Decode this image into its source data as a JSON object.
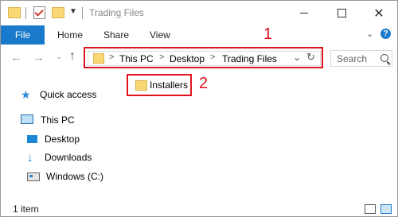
{
  "window": {
    "title": "Trading Files",
    "minimize_icon": "minimize-icon",
    "maximize_icon": "maximize-icon",
    "close_glyph": "✕"
  },
  "ribbon": {
    "file_label": "File",
    "tabs": [
      "Home",
      "Share",
      "View"
    ],
    "expand_glyph": "⌄",
    "help_glyph": "?"
  },
  "nav": {
    "back_glyph": "←",
    "forward_glyph": "→",
    "recent_glyph": "⌄",
    "up_glyph": "↑"
  },
  "address": {
    "crumbs": [
      "This PC",
      "Desktop",
      "Trading Files"
    ],
    "separator": ">",
    "dropdown_glyph": "⌄",
    "refresh_glyph": "↻"
  },
  "annotations": {
    "label_1": "1",
    "label_2": "2",
    "color": "#e0141e"
  },
  "search": {
    "placeholder": "Search"
  },
  "sidebar": {
    "items": [
      {
        "label": "Quick access",
        "icon": "star-icon"
      },
      {
        "label": "This PC",
        "icon": "computer-icon"
      },
      {
        "label": "Desktop",
        "icon": "desktop-icon"
      },
      {
        "label": "Downloads",
        "icon": "download-icon"
      },
      {
        "label": "Windows (C:)",
        "icon": "drive-icon"
      }
    ]
  },
  "content": {
    "items": [
      {
        "label": "Installers",
        "icon": "folder-icon"
      }
    ]
  },
  "status": {
    "item_count": "1 item"
  },
  "colors": {
    "accent": "#1979ca",
    "folder": "#f8d775"
  }
}
